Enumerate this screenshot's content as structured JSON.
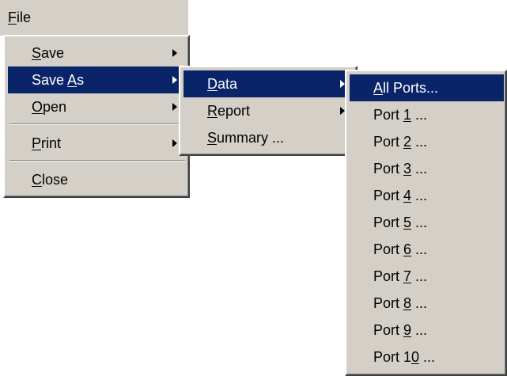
{
  "menubar": {
    "file": {
      "pre": "",
      "key": "F",
      "post": "ile"
    }
  },
  "file_menu": {
    "save": {
      "pre": "",
      "key": "S",
      "post": "ave"
    },
    "save_as": {
      "pre": "Save ",
      "key": "A",
      "post": "s"
    },
    "open": {
      "pre": "",
      "key": "O",
      "post": "pen"
    },
    "print": {
      "pre": "",
      "key": "P",
      "post": "rint"
    },
    "close": {
      "pre": "",
      "key": "C",
      "post": "lose"
    }
  },
  "save_as_menu": {
    "data": {
      "pre": "",
      "key": "D",
      "post": "ata"
    },
    "report": {
      "pre": "",
      "key": "R",
      "post": "eport"
    },
    "summary": {
      "pre": "",
      "key": "S",
      "post": "ummary ..."
    }
  },
  "data_menu": {
    "items": [
      {
        "pre": "",
        "key": "A",
        "post": "ll Ports..."
      },
      {
        "pre": "Port ",
        "key": "1",
        "post": " ..."
      },
      {
        "pre": "Port ",
        "key": "2",
        "post": " ..."
      },
      {
        "pre": "Port ",
        "key": "3",
        "post": " ..."
      },
      {
        "pre": "Port ",
        "key": "4",
        "post": " ..."
      },
      {
        "pre": "Port ",
        "key": "5",
        "post": " ..."
      },
      {
        "pre": "Port ",
        "key": "6",
        "post": " ..."
      },
      {
        "pre": "Port ",
        "key": "7",
        "post": " ..."
      },
      {
        "pre": "Port ",
        "key": "8",
        "post": " ..."
      },
      {
        "pre": "Port ",
        "key": "9",
        "post": " ..."
      },
      {
        "pre": "Port 1",
        "key": "0",
        "post": " ..."
      }
    ]
  },
  "colors": {
    "menu_face": "#d4d0c8",
    "highlight": "#0a246a",
    "highlight_text": "#ffffff"
  }
}
